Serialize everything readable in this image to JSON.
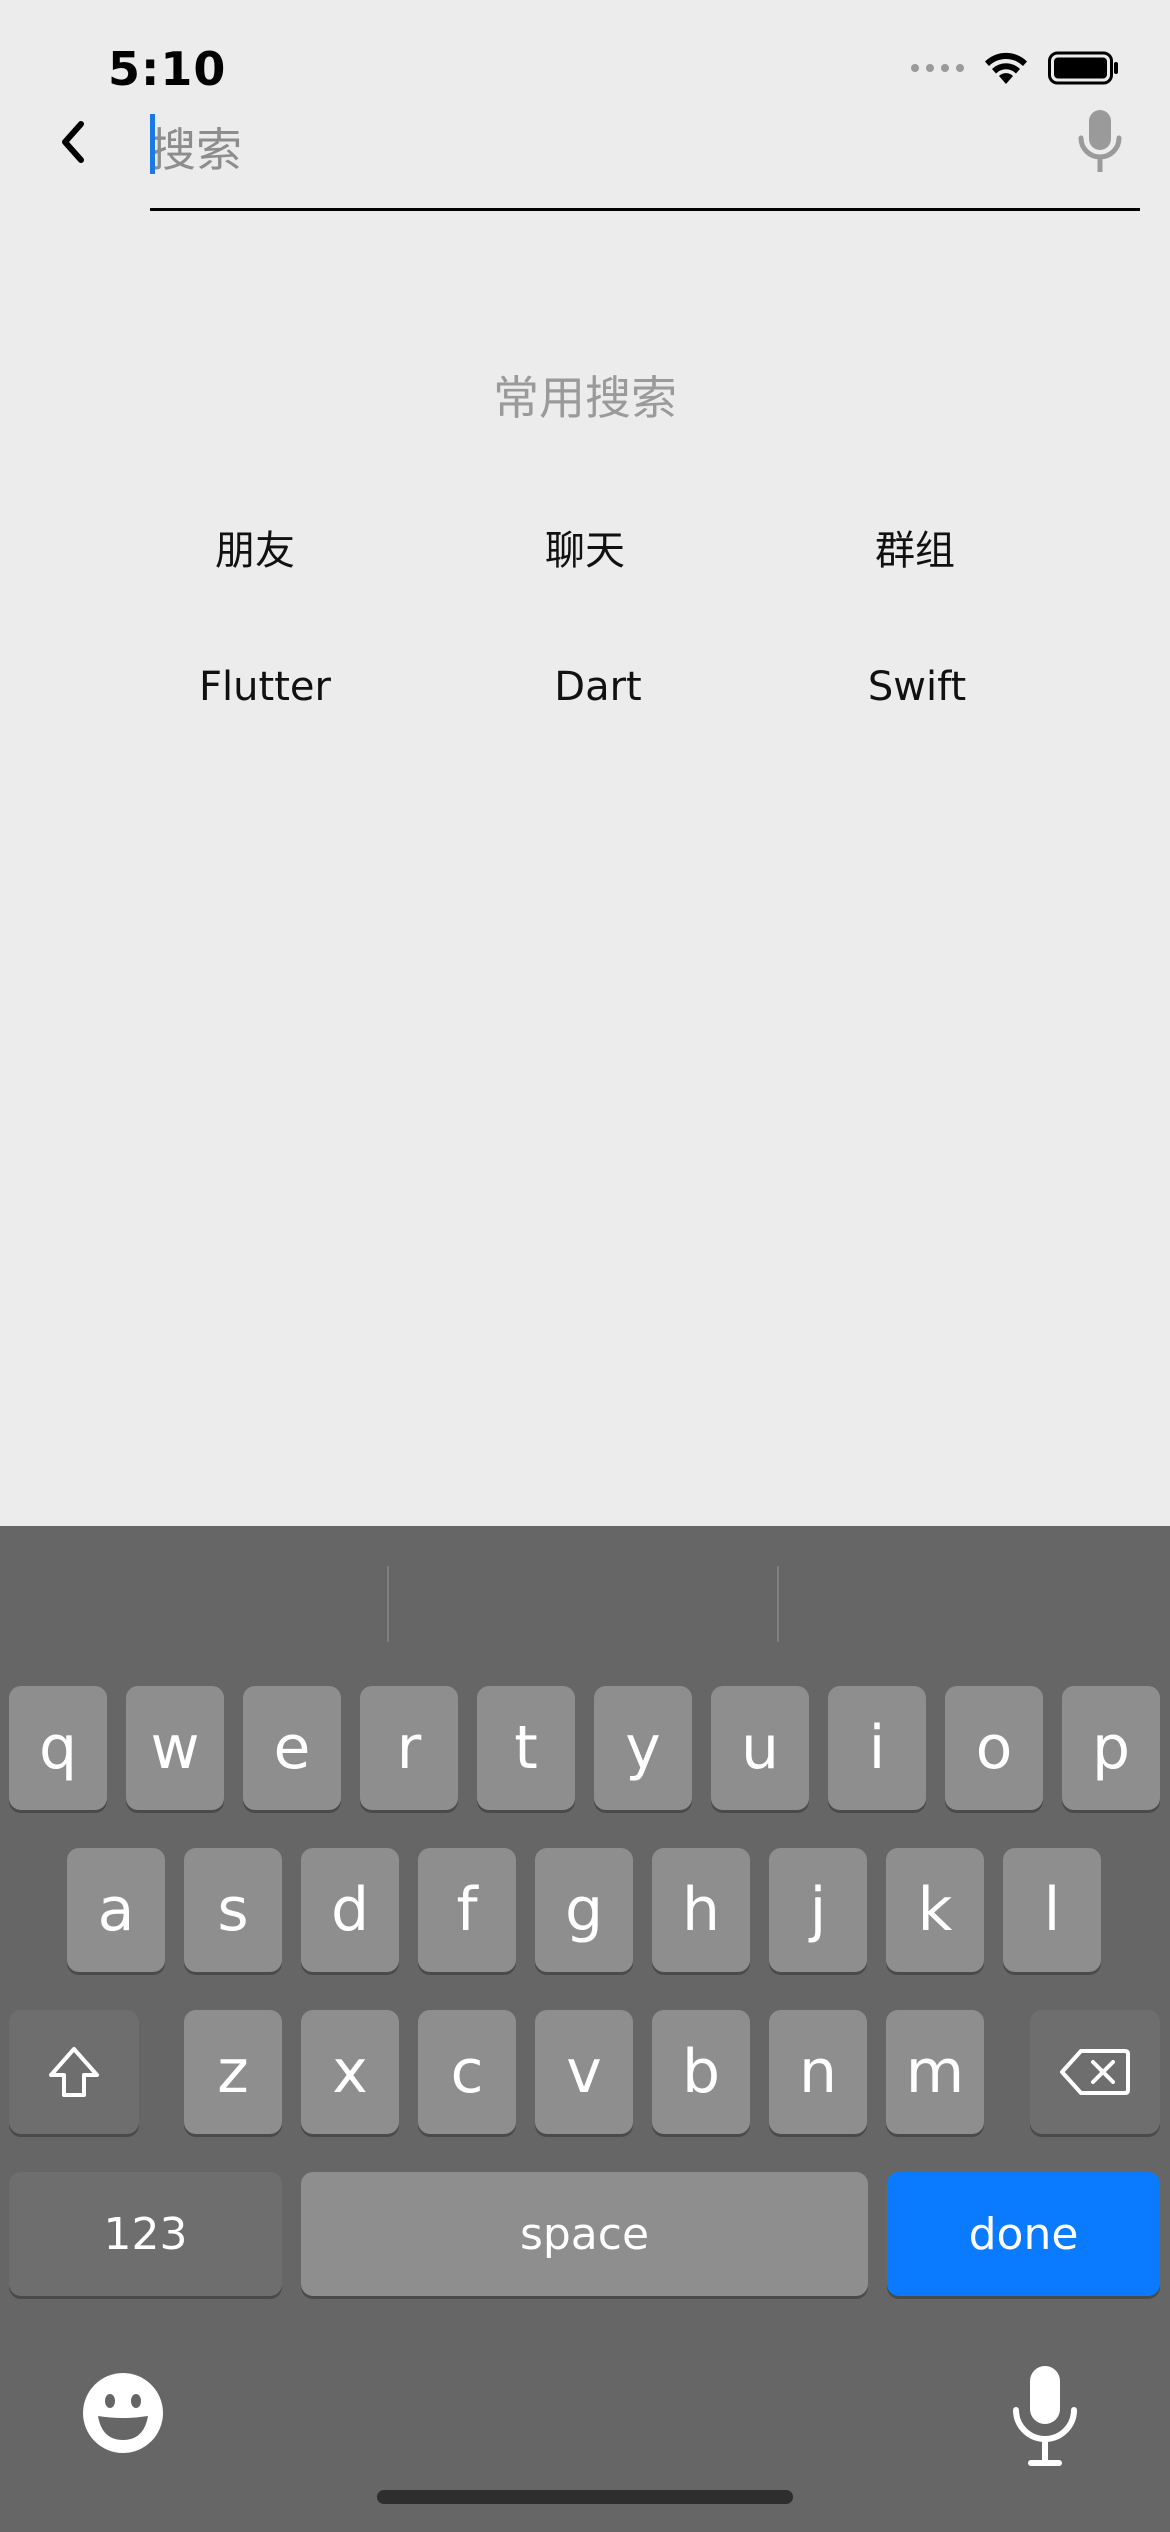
{
  "status_bar": {
    "time": "5:10"
  },
  "search": {
    "placeholder": "搜索",
    "value": ""
  },
  "common_search": {
    "title": "常用搜索",
    "items": [
      "朋友",
      "聊天",
      "群组",
      "Flutter",
      "Dart",
      "Swift"
    ]
  },
  "keyboard": {
    "row1": [
      "q",
      "w",
      "e",
      "r",
      "t",
      "y",
      "u",
      "i",
      "o",
      "p"
    ],
    "row2": [
      "a",
      "s",
      "d",
      "f",
      "g",
      "h",
      "j",
      "k",
      "l"
    ],
    "row3": [
      "z",
      "x",
      "c",
      "v",
      "b",
      "n",
      "m"
    ],
    "numbers_label": "123",
    "space_label": "space",
    "done_label": "done"
  },
  "colors": {
    "accent": "#0a7aff",
    "background": "#ececec",
    "keyboard": "#666666"
  },
  "icons": [
    "back-chevron-icon",
    "microphone-icon",
    "signal-dots-icon",
    "wifi-icon",
    "battery-icon",
    "shift-icon",
    "delete-icon",
    "emoji-icon",
    "dictation-icon"
  ]
}
